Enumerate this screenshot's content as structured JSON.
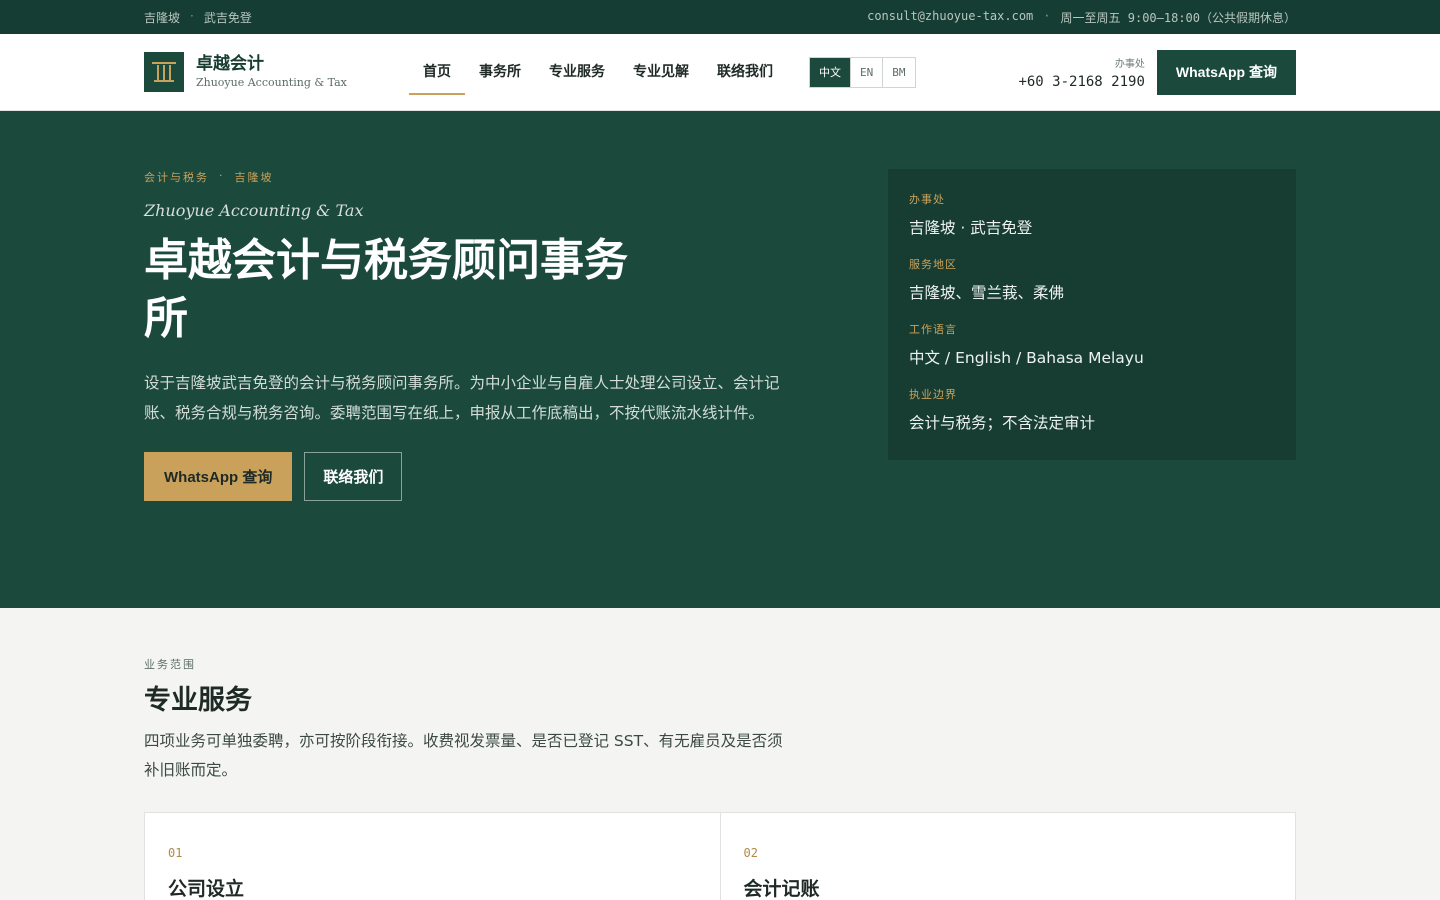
{
  "topbar": {
    "location_city": "吉隆坡",
    "location_sep": "·",
    "location_area": "武吉免登",
    "email": "consult@zhuoyue-tax.com",
    "info_sep": "·",
    "hours": "周一至周五 9:00–18:00（公共假期休息）"
  },
  "nav": {
    "brand_cn": "卓越会计",
    "brand_en": "Zhuoyue Accounting & Tax",
    "menu": [
      {
        "label": "首页",
        "active": true
      },
      {
        "label": "事务所"
      },
      {
        "label": "专业服务"
      },
      {
        "label": "专业见解"
      },
      {
        "label": "联络我们"
      }
    ],
    "lang": [
      "中文",
      "EN",
      "BM"
    ],
    "office_label": "办事处",
    "phone": "+60 3-2168 2190",
    "whatsapp_label": "WhatsApp 查询"
  },
  "hero": {
    "eyebrow_a": "会计与税务",
    "eyebrow_sep": "·",
    "eyebrow_b": "吉隆坡",
    "subtitle_en": "Zhuoyue Accounting & Tax",
    "title": "卓越会计与税务顾问事务所",
    "description": "设于吉隆坡武吉免登的会计与税务顾问事务所。为中小企业与自雇人士处理公司设立、会计记账、税务合规与税务咨询。委聘范围写在纸上，申报从工作底稿出，不按代账流水线计件。",
    "primary_cta": "WhatsApp 查询",
    "secondary_cta": "联络我们"
  },
  "info_card": [
    {
      "key": "办事处",
      "value": "吉隆坡 · 武吉免登"
    },
    {
      "key": "服务地区",
      "value": "吉隆坡、雪兰莪、柔佛"
    },
    {
      "key": "工作语言",
      "value": "中文 / English / Bahasa Melayu"
    },
    {
      "key": "执业边界",
      "value": "会计与税务；不含法定审计"
    }
  ],
  "services": {
    "eyebrow": "业务范围",
    "title": "专业服务",
    "description": "四项业务可单独委聘，亦可按阶段衔接。收费视发票量、是否已登记 SST、有无雇员及是否须补旧账而定。",
    "cards": [
      {
        "num": "01",
        "title": "公司设立"
      },
      {
        "num": "02",
        "title": "会计记账"
      }
    ]
  },
  "colors": {
    "primary": "#1b4a3d",
    "dark": "#163d33",
    "accent": "#c9a15a"
  }
}
